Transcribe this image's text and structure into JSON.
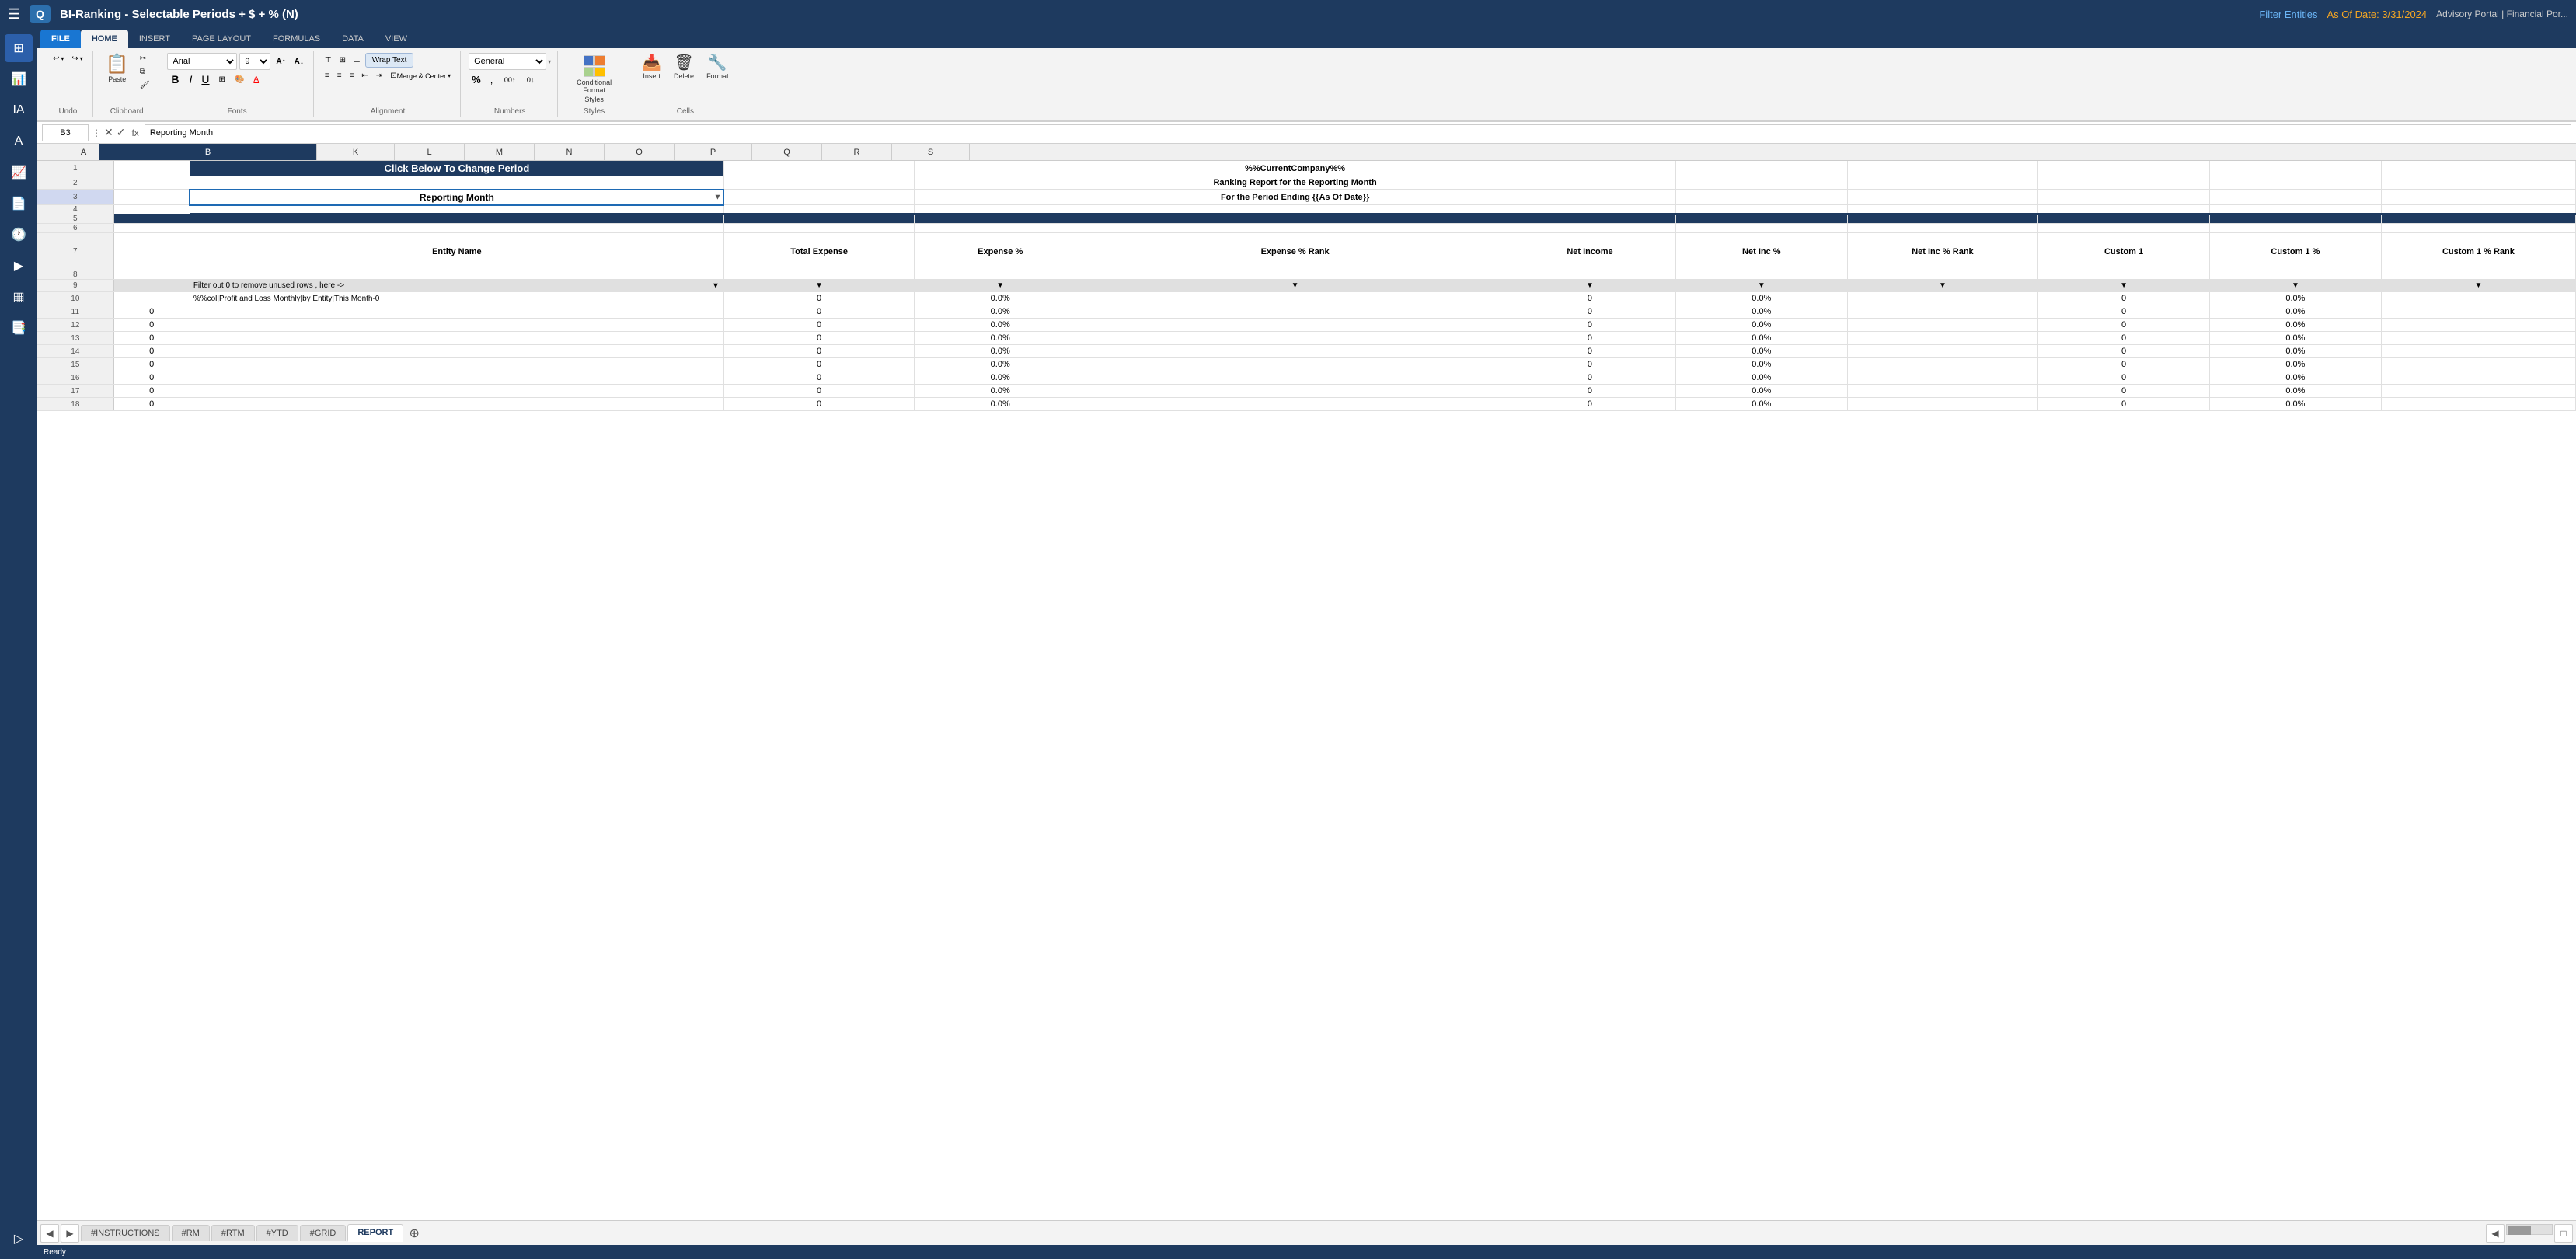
{
  "app": {
    "title": "BI-Ranking - Selectable Periods + $ + % (N)",
    "logo": "Q",
    "menu_icon": "☰",
    "top_links": {
      "filter": "Filter Entities",
      "date_label": "As Of Date: 3/31/2024",
      "portal": "Advisory Portal | Financial Por..."
    },
    "status_bar": "Ready"
  },
  "ribbon": {
    "tabs": [
      "FILE",
      "HOME",
      "INSERT",
      "PAGE LAYOUT",
      "FORMULAS",
      "DATA",
      "VIEW"
    ],
    "active_tab": "HOME",
    "groups": {
      "undo": {
        "label": "Undo",
        "undo_icon": "↩",
        "redo_icon": "↪"
      },
      "clipboard": {
        "label": "Clipboard",
        "paste_label": "Paste",
        "cut_label": "✂",
        "copy_label": "⧉",
        "format_painter_label": "🖌"
      },
      "fonts": {
        "label": "Fonts",
        "font_name": "Arial",
        "font_size": "9",
        "bold": "B",
        "italic": "I",
        "underline": "U",
        "grow_font": "A",
        "shrink_font": "A"
      },
      "alignment": {
        "label": "Alignment",
        "align_left": "≡",
        "align_center": "≡",
        "align_right": "≡",
        "align_top": "⊤",
        "align_middle": "⊞",
        "align_bottom": "⊥",
        "wrap_text": "Wrap Text",
        "merge_center": "Merge & Center"
      },
      "numbers": {
        "label": "Numbers",
        "format": "General",
        "percent": "%",
        "comma": ",",
        "increase_decimal": ".00",
        "decrease_decimal": ".0"
      },
      "styles": {
        "label": "Styles",
        "conditional_format": "Conditional Format",
        "cf_subtitle": "Styles"
      },
      "cells": {
        "label": "Cells",
        "insert": "Insert",
        "delete": "Delete",
        "format": "Format"
      }
    }
  },
  "formula_bar": {
    "cell_ref": "B3",
    "formula": "Reporting Month"
  },
  "columns": {
    "headers": [
      "A",
      "B",
      "K",
      "L",
      "M",
      "N",
      "O",
      "P",
      "Q",
      "R",
      "S"
    ]
  },
  "sheet": {
    "rows": [
      {
        "num": 1,
        "a": "",
        "b": "Click Below To Change Period",
        "k": "",
        "l": "",
        "m": "%%CurrentCompany%%",
        "n": "",
        "o": "",
        "p": "",
        "q": "",
        "r": "",
        "s": ""
      },
      {
        "num": 2,
        "a": "",
        "b": "",
        "k": "",
        "l": "",
        "m": "Ranking Report for the Reporting Month",
        "n": "",
        "o": "",
        "p": "",
        "q": "",
        "r": "",
        "s": ""
      },
      {
        "num": 3,
        "a": "",
        "b": "Reporting Month",
        "k": "",
        "l": "",
        "m": "For the Period Ending {{As Of Date}}",
        "n": "",
        "o": "",
        "p": "",
        "q": "",
        "r": "",
        "s": ""
      },
      {
        "num": 4,
        "a": "",
        "b": "",
        "k": "",
        "l": "",
        "m": "",
        "n": "",
        "o": "",
        "p": "",
        "q": "",
        "r": "",
        "s": ""
      },
      {
        "num": 5,
        "a": "",
        "b": "",
        "k": "",
        "l": "",
        "m": "",
        "n": "",
        "o": "",
        "p": "",
        "q": "",
        "r": "",
        "s": ""
      },
      {
        "num": 6,
        "a": "",
        "b": "",
        "k": "",
        "l": "",
        "m": "",
        "n": "",
        "o": "",
        "p": "",
        "q": "",
        "r": "",
        "s": ""
      },
      {
        "num": 7,
        "a": "",
        "b": "Entity Name",
        "k": "Total Expense",
        "l": "Expense %",
        "m": "Expense % Rank",
        "n": "Net Income",
        "o": "Net Inc %",
        "p": "Net Inc % Rank",
        "q": "Custom 1",
        "r": "Custom 1 %",
        "s": "Custom 1 % Rank"
      },
      {
        "num": 8,
        "a": "",
        "b": "",
        "k": "",
        "l": "",
        "m": "",
        "n": "",
        "o": "",
        "p": "",
        "q": "",
        "r": "",
        "s": ""
      },
      {
        "num": 9,
        "a": "",
        "b": "Filter out 0 to remove unused rows , here ->",
        "k": "▼",
        "l": "▼",
        "m": "▼",
        "n": "▼",
        "o": "▼",
        "p": "▼",
        "q": "▼",
        "r": "▼",
        "s": "▼"
      },
      {
        "num": 10,
        "a": "",
        "b": "%%col|Profit and Loss Monthly|by Entity|This Month-0",
        "k": "0",
        "l": "0.0%",
        "m": "",
        "n": "0",
        "o": "0.0%",
        "p": "",
        "q": "0",
        "r": "0.0%",
        "s": ""
      },
      {
        "num": 11,
        "a": "0",
        "b": "",
        "k": "0",
        "l": "0.0%",
        "m": "",
        "n": "0",
        "o": "0.0%",
        "p": "",
        "q": "0",
        "r": "0.0%",
        "s": ""
      },
      {
        "num": 12,
        "a": "0",
        "b": "",
        "k": "0",
        "l": "0.0%",
        "m": "",
        "n": "0",
        "o": "0.0%",
        "p": "",
        "q": "0",
        "r": "0.0%",
        "s": ""
      },
      {
        "num": 13,
        "a": "0",
        "b": "",
        "k": "0",
        "l": "0.0%",
        "m": "",
        "n": "0",
        "o": "0.0%",
        "p": "",
        "q": "0",
        "r": "0.0%",
        "s": ""
      },
      {
        "num": 14,
        "a": "0",
        "b": "",
        "k": "0",
        "l": "0.0%",
        "m": "",
        "n": "0",
        "o": "0.0%",
        "p": "",
        "q": "0",
        "r": "0.0%",
        "s": ""
      },
      {
        "num": 15,
        "a": "0",
        "b": "",
        "k": "0",
        "l": "0.0%",
        "m": "",
        "n": "0",
        "o": "0.0%",
        "p": "",
        "q": "0",
        "r": "0.0%",
        "s": ""
      },
      {
        "num": 16,
        "a": "0",
        "b": "",
        "k": "0",
        "l": "0.0%",
        "m": "",
        "n": "0",
        "o": "0.0%",
        "p": "",
        "q": "0",
        "r": "0.0%",
        "s": ""
      },
      {
        "num": 17,
        "a": "0",
        "b": "",
        "k": "0",
        "l": "0.0%",
        "m": "",
        "n": "0",
        "o": "0.0%",
        "p": "",
        "q": "0",
        "r": "0.0%",
        "s": ""
      },
      {
        "num": 18,
        "a": "0",
        "b": "",
        "k": "0",
        "l": "0.0%",
        "m": "",
        "n": "0",
        "o": "0.0%",
        "p": "",
        "q": "0",
        "r": "0.0%",
        "s": ""
      }
    ]
  },
  "sheets": {
    "tabs": [
      "#INSTRUCTIONS",
      "#RM",
      "#RTM",
      "#YTD",
      "#GRID",
      "REPORT"
    ],
    "active": "REPORT"
  },
  "sidebar": {
    "icons": [
      {
        "name": "grid-icon",
        "symbol": "⊞",
        "active": true
      },
      {
        "name": "analytics-icon",
        "symbol": "📊",
        "active": false
      },
      {
        "name": "user-icon",
        "symbol": "👤",
        "active": false
      },
      {
        "name": "document-icon",
        "symbol": "📄",
        "active": false
      },
      {
        "name": "clock-icon",
        "symbol": "🕐",
        "active": false
      },
      {
        "name": "forward-icon",
        "symbol": "▶",
        "active": false
      },
      {
        "name": "table-icon",
        "symbol": "▦",
        "active": false
      },
      {
        "name": "pdf-icon",
        "symbol": "📑",
        "active": false
      }
    ]
  }
}
